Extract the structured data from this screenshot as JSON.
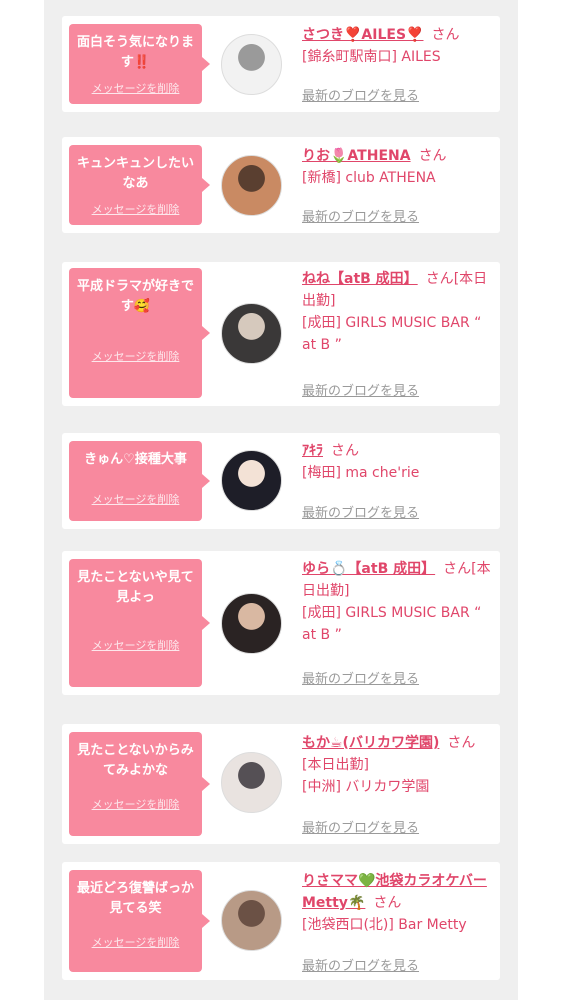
{
  "delete_label": "メッセージを削除",
  "blog_label": "最新のブログを見る",
  "san_label": "さん",
  "entries": [
    {
      "message": "面白そう気になります‼️",
      "name": "さつき❣️AILES❣️",
      "status": "",
      "location": "[錦糸町駅南口] AILES",
      "avatar_colors": [
        "#f2f2f2",
        "#9a9a9a"
      ]
    },
    {
      "message": "キュンキュンしたいなあ",
      "name": "りお🌷ATHENA",
      "status": "",
      "location": "[新橋] club ATHENA",
      "avatar_colors": [
        "#c98a63",
        "#5a3f30"
      ]
    },
    {
      "message": "平成ドラマが好きです🥰",
      "name": "ねね【atB 成田】",
      "status": "[本日出勤]",
      "location": "[成田] GIRLS MUSIC BAR “ at B ”",
      "avatar_colors": [
        "#3a3838",
        "#d6c9bd"
      ]
    },
    {
      "message": "きゅん♡接種大事",
      "name": "ｱｷﾗ",
      "status": "",
      "location": "[梅田] ma che'rie",
      "avatar_colors": [
        "#1e1e28",
        "#f3e2d6"
      ]
    },
    {
      "message": "見たことないや見て見よっ",
      "name": "ゆら💍【atB 成田】",
      "status": "[本日出勤]",
      "location": "[成田] GIRLS MUSIC BAR “ at B ”",
      "avatar_colors": [
        "#2a2323",
        "#d9b8a2"
      ]
    },
    {
      "message": "見たことないからみてみよかな",
      "name": "もか☕(バリカワ学園)",
      "status": "[本日出勤]",
      "location": "[中洲] バリカワ学園",
      "avatar_colors": [
        "#e9e3e0",
        "#555055"
      ]
    },
    {
      "message": "最近どろ復讐ばっか見てる笑",
      "name": "りさママ💚池袋カラオケバーMetty🌴",
      "status": "",
      "location": "[池袋西口(北)] Bar Metty",
      "avatar_colors": [
        "#b89a86",
        "#6b5145"
      ]
    }
  ]
}
